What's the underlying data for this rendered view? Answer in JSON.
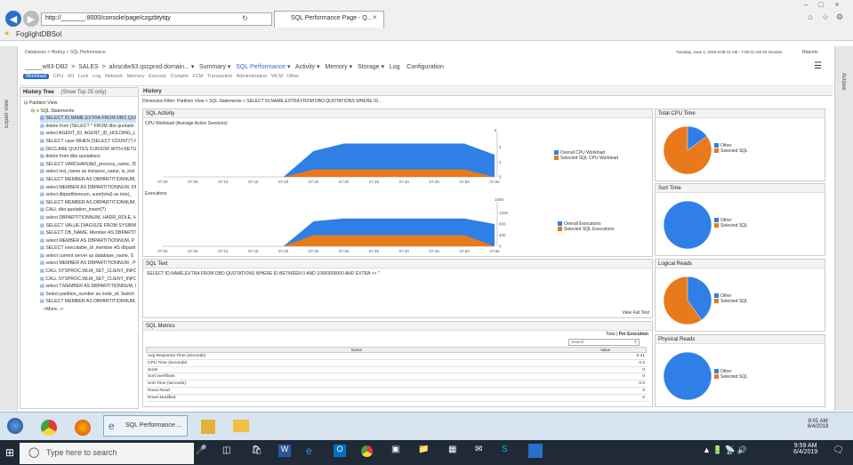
{
  "browser": {
    "url": "http://_______:8000/console/page/czgzbtytqy",
    "tab_title": "SQL Performance Page - Q...",
    "favorite": "FoglightDBSol"
  },
  "breadcrumb": [
    "Databases",
    "History",
    "SQL Performance"
  ],
  "datetime": "Tuesday, June 4, 2019 6:08:41 AM - 7:38:41 AM 65 minutes",
  "reports": "Reports",
  "instance": {
    "name": "_____w93-DB2",
    "db": "SALES",
    "host": "alvscdw93.qscprod.domain..."
  },
  "menu": [
    "Summary",
    "SQL Performance",
    "Activity",
    "Memory",
    "Storage",
    "Log",
    "Configuration"
  ],
  "submenu": [
    "Workload",
    "CPU",
    "I/O",
    "Lock",
    "Log",
    "Network",
    "Memory",
    "Execute",
    "Compile",
    "FCM",
    "Transaction",
    "Administration",
    "WLM",
    "Other"
  ],
  "left_panel": {
    "title": "Expert View"
  },
  "right_panel": {
    "title": "Actions"
  },
  "history_tree": {
    "title": "History Tree",
    "show": "(Show Top 25 only)",
    "root": "Partition View",
    "group": "SQL Statements",
    "items": [
      "SELECT ID,NAME,EXTRA FROM DBO.QUOTATIO",
      "delete from (SELECT * FROM dbo.quotatio",
      "select AGENT_ID, AGENT_ID_HOLDING_L",
      "SELECT case WHEN (SELECT COUNT(*) F",
      "DECLARE QUOTES CURSOR WITH RETURN",
      "delete from dbo.quotations",
      "SELECT VARCHAR(db2_process_name, 30",
      "select inst_name as instance_name, is_inst",
      "SELECT MEMBER AS DBPARTITIONNUM, a",
      "select MEMBER AS DBPARTITIONNUM, DB",
      "select dbpartitionnum, sum(total) as total_",
      "SELECT MEMBER AS DBPARTITIONNUM, S",
      "CALL dbo.quotation_insert(?)",
      "select DBPARTITIONNUM, HADR_ROLE, H",
      "SELECT VALUE DIAGSIZE FROM SYSIBMAD",
      "SELECT DB_NAME, Member AS DBPARTIT",
      "select MEMBER AS DBPARTITIONNUM, P",
      "SELECT executable_id ,member AS dbparti",
      "select current server as database_name, S",
      "select MEMBER AS DBPARTITIONNUM , PO",
      "CALL SYSPROC.WLM_SET_CLIENT_INFO(?",
      "CALL SYSPROC.WLM_SET_CLIENT_INFO(?",
      "select T.MEMBER AS DBPARTITIONNUM, C",
      "Select partition_number as node_id, Switch",
      "SELECT MEMBER AS DBPARTITIONNUM, C"
    ],
    "more": "<More...>"
  },
  "history": {
    "title": "History",
    "dimension": "Dimension Filter: Partition View  >  SQL Statements  >  SELECT ID,NAME,EXTRA FROM DBO.QUOTATIONS WHERE ID..."
  },
  "sql_activity": {
    "title": "SQL Activity",
    "chart1": {
      "title": "CPU Workload (Average Active Sessions)",
      "legend": [
        "Overall CPU Workload",
        "Selected SQL CPU Workload"
      ],
      "ymax": "6",
      "yticks": [
        "4",
        "2",
        "0"
      ]
    },
    "chart2": {
      "title": "Executions",
      "legend": [
        "Overall Executions",
        "Selected SQL Executions"
      ],
      "ymax": "1600",
      "yticks": [
        "1200",
        "800",
        "400",
        "0"
      ]
    }
  },
  "chart_data": [
    {
      "type": "area",
      "title": "CPU Workload (Average Active Sessions)",
      "x": [
        "07:00",
        "07:05",
        "07:10",
        "07:15",
        "07:20",
        "07:25",
        "07:30",
        "07:35",
        "07:40",
        "07:45",
        "07:50",
        "07:55"
      ],
      "series": [
        {
          "name": "Overall CPU Workload",
          "values": [
            0,
            0,
            0,
            0,
            0,
            3.5,
            4.5,
            4.5,
            4.5,
            4.5,
            4.5,
            3
          ]
        },
        {
          "name": "Selected SQL CPU Workload",
          "values": [
            0,
            0,
            0,
            0,
            0,
            1,
            1,
            1,
            1,
            1,
            1,
            0
          ]
        }
      ],
      "ylim": [
        0,
        6
      ]
    },
    {
      "type": "area",
      "title": "Executions",
      "x": [
        "07:00",
        "07:05",
        "07:10",
        "07:15",
        "07:20",
        "07:25",
        "07:30",
        "07:35",
        "07:40",
        "07:45",
        "07:50",
        "07:55"
      ],
      "series": [
        {
          "name": "Overall Executions",
          "values": [
            0,
            0,
            0,
            0,
            0,
            900,
            1000,
            1000,
            1000,
            1000,
            1000,
            800
          ]
        },
        {
          "name": "Selected SQL Executions",
          "values": [
            0,
            0,
            0,
            0,
            0,
            400,
            400,
            400,
            400,
            400,
            400,
            0
          ]
        }
      ],
      "ylim": [
        0,
        1600
      ]
    }
  ],
  "total_cpu": {
    "title": "Total CPU Time",
    "legend": [
      "Other",
      "Selected SQL"
    ],
    "selected_fraction": 0.15
  },
  "sort_time": {
    "title": "Sort Time",
    "legend": [
      "Other",
      "Selected SQL"
    ],
    "selected_fraction": 0.0
  },
  "logical_reads": {
    "title": "Logical Reads",
    "legend": [
      "Other",
      "Selected SQL"
    ],
    "selected_fraction": 0.4
  },
  "physical_reads": {
    "title": "Physical Reads",
    "legend": [
      "Other",
      "Selected SQL"
    ],
    "selected_fraction": 0.0
  },
  "sql_text": {
    "title": "SQL Text",
    "text": "SELECT ID,NAME,EXTRA FROM DBO.QUOTATIONS WHERE ID BETWEEN 0 AND 10000000000 AND EXTRA <> ''",
    "view_full": "View Full Text"
  },
  "sql_metrics": {
    "title": "SQL Metrics",
    "total_label": "Total",
    "per_exec": "Per Execution",
    "search_placeholder": "Search",
    "col_name": "Name",
    "col_value": "Value",
    "rows": [
      [
        "Avg Response Time (seconds)",
        "0.41"
      ],
      [
        "CPU Time (seconds)",
        "0.2"
      ],
      [
        "Sorts",
        "0"
      ],
      [
        "Sort overflows",
        "0"
      ],
      [
        "Sort Time (seconds)",
        "0.0"
      ],
      [
        "Rows Read",
        "0"
      ],
      [
        "Rows Modified",
        "0"
      ]
    ]
  },
  "taskbar": {
    "app_label": "SQL Performance ...",
    "time1": "8:01 AM",
    "date1": "6/4/2019",
    "time2": "9:59 AM",
    "date2": "6/4/2019",
    "search": "Type here to search"
  },
  "colors": {
    "blue": "#2f7fe6",
    "orange": "#e97a1c"
  }
}
